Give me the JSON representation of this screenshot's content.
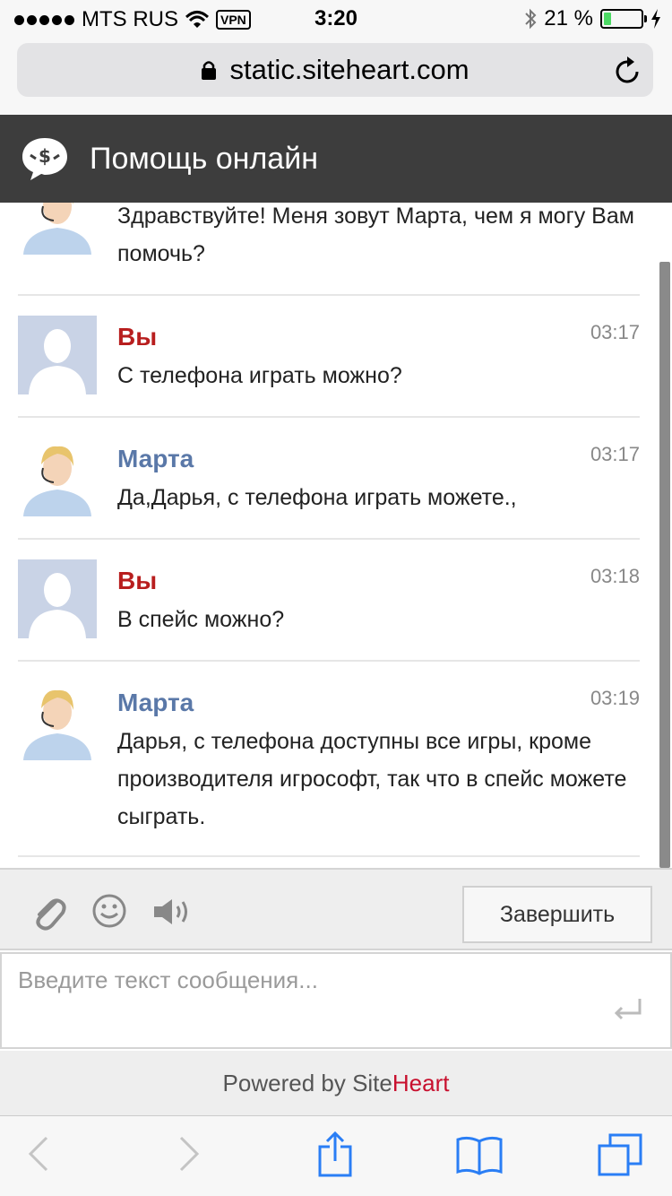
{
  "status": {
    "carrier": "MTS RUS",
    "vpn": "VPN",
    "time": "3:20",
    "battery": "21 %",
    "battery_level": 0.21
  },
  "browser": {
    "url": "static.siteheart.com"
  },
  "chat": {
    "title": "Помощь онлайн"
  },
  "messages": [
    {
      "author": "",
      "time": "",
      "text": "Здравствуйте! Меня зовут Марта, чем я могу Вам помочь?"
    },
    {
      "author": "Вы",
      "time": "03:17",
      "text": "С телефона играть можно?"
    },
    {
      "author": "Марта",
      "time": "03:17",
      "text": "Да,Дарья, с телефона играть можете.,"
    },
    {
      "author": "Вы",
      "time": "03:18",
      "text": "В спейс можно?"
    },
    {
      "author": "Марта",
      "time": "03:19",
      "text": "Дарья, с телефона доступны все игры, кроме производителя игрософт, так что в спейс можете сыграть."
    }
  ],
  "toolbar": {
    "end_label": "Завершить"
  },
  "input": {
    "placeholder": "Введите текст сообщения..."
  },
  "footer": {
    "powered_prefix": "Powered by ",
    "brand_site": "Site",
    "brand_heart": "Heart"
  },
  "colors": {
    "header_bg": "#3d3d3d",
    "you": "#b81e1e",
    "operator": "#5a78a8",
    "brand_heart": "#c8102e"
  }
}
